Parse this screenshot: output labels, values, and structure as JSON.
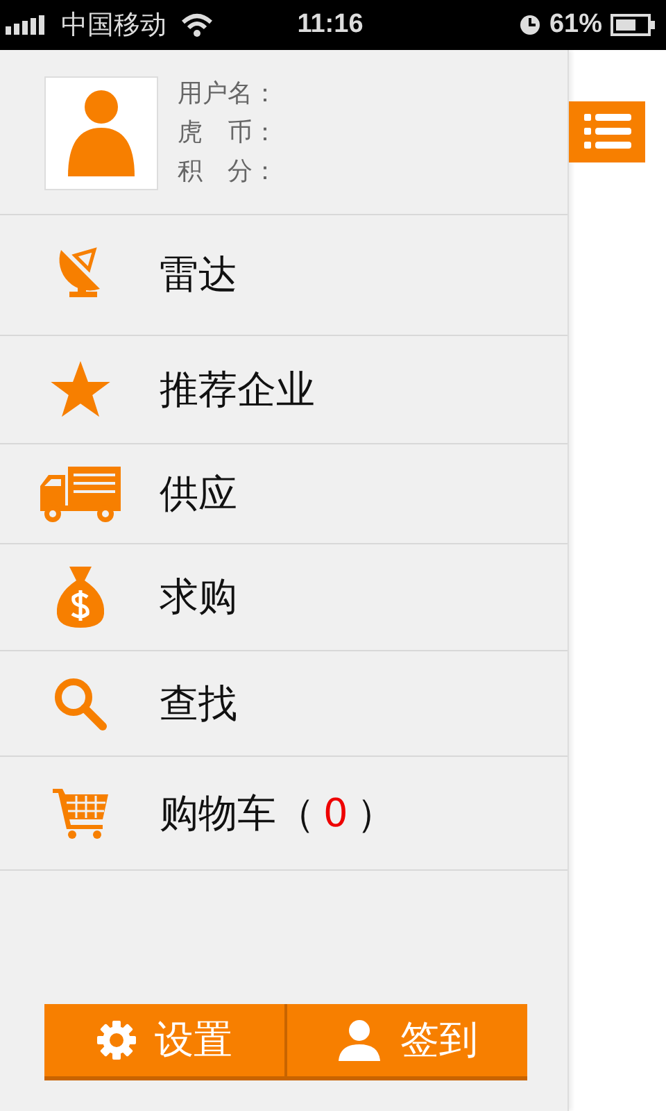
{
  "status_bar": {
    "carrier": "中国移动",
    "time": "11:16",
    "battery": "61%"
  },
  "profile": {
    "fields": [
      "用户名：",
      "虎　币：",
      "积　分："
    ]
  },
  "menu": [
    {
      "kind": "radar",
      "label": "雷达"
    },
    {
      "kind": "star",
      "label": "推荐企业"
    },
    {
      "kind": "truck",
      "label": "供应"
    },
    {
      "kind": "moneybag",
      "label": "求购"
    },
    {
      "kind": "search",
      "label": "查找"
    },
    {
      "kind": "cart",
      "label": "购物车（",
      "count": "0",
      "label_end": "）"
    }
  ],
  "buttons": [
    {
      "kind": "settings",
      "label": "设置"
    },
    {
      "kind": "checkin",
      "label": "签到"
    }
  ]
}
